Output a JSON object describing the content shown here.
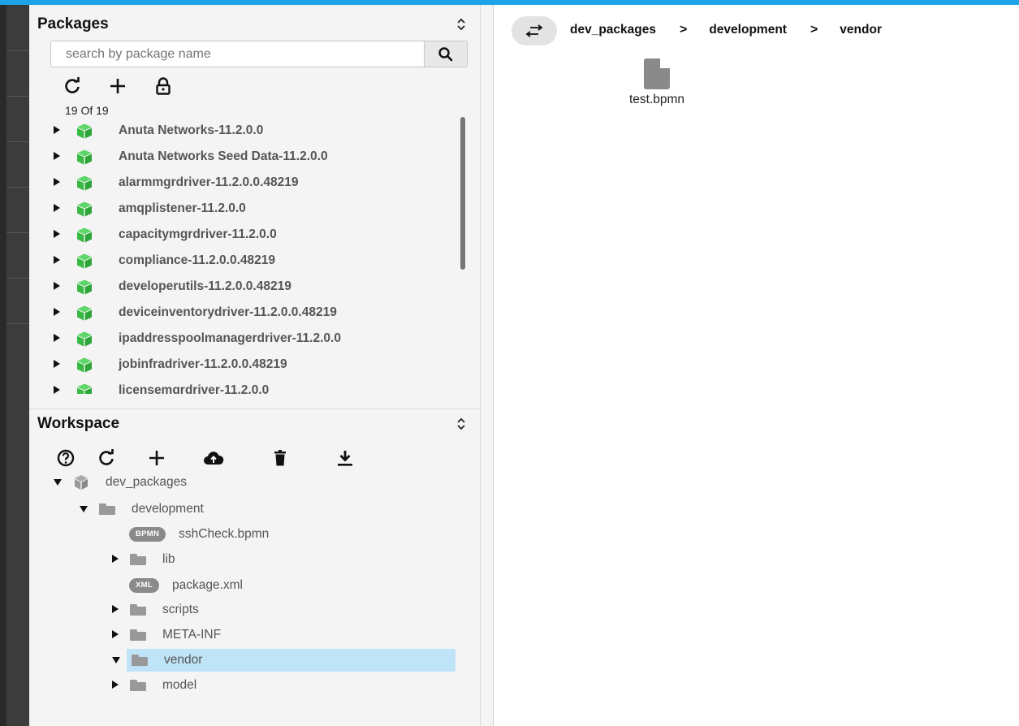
{
  "packages": {
    "title": "Packages",
    "search_placeholder": "search by package name",
    "count_text": "19 Of 19",
    "items": [
      {
        "label": "Anuta Networks-11.2.0.0"
      },
      {
        "label": "Anuta Networks Seed Data-11.2.0.0"
      },
      {
        "label": "alarmmgrdriver-11.2.0.0.48219"
      },
      {
        "label": "amqplistener-11.2.0.0"
      },
      {
        "label": "capacitymgrdriver-11.2.0.0"
      },
      {
        "label": "compliance-11.2.0.0.48219"
      },
      {
        "label": "developerutils-11.2.0.0.48219"
      },
      {
        "label": "deviceinventorydriver-11.2.0.0.48219"
      },
      {
        "label": "ipaddresspoolmanagerdriver-11.2.0.0"
      },
      {
        "label": "jobinfradriver-11.2.0.0.48219"
      },
      {
        "label": "licensemgrdriver-11.2.0.0"
      }
    ],
    "colors": {
      "cube": "#3cc04a",
      "accent": "#1ca3e8"
    }
  },
  "workspace": {
    "title": "Workspace",
    "tree": {
      "root": "dev_packages",
      "development": "development",
      "ssh_badge": "BPMN",
      "ssh_file": "sshCheck.bpmn",
      "lib": "lib",
      "xml_badge": "XML",
      "package_xml": "package.xml",
      "scripts": "scripts",
      "meta_inf": "META-INF",
      "vendor": "vendor",
      "model": "model"
    },
    "selection_color": "#bfe3f7"
  },
  "breadcrumb": {
    "items": [
      "dev_packages",
      "development",
      "vendor"
    ],
    "separator": ">"
  },
  "files": [
    {
      "name": "test.bpmn",
      "icon": "file-icon"
    }
  ]
}
